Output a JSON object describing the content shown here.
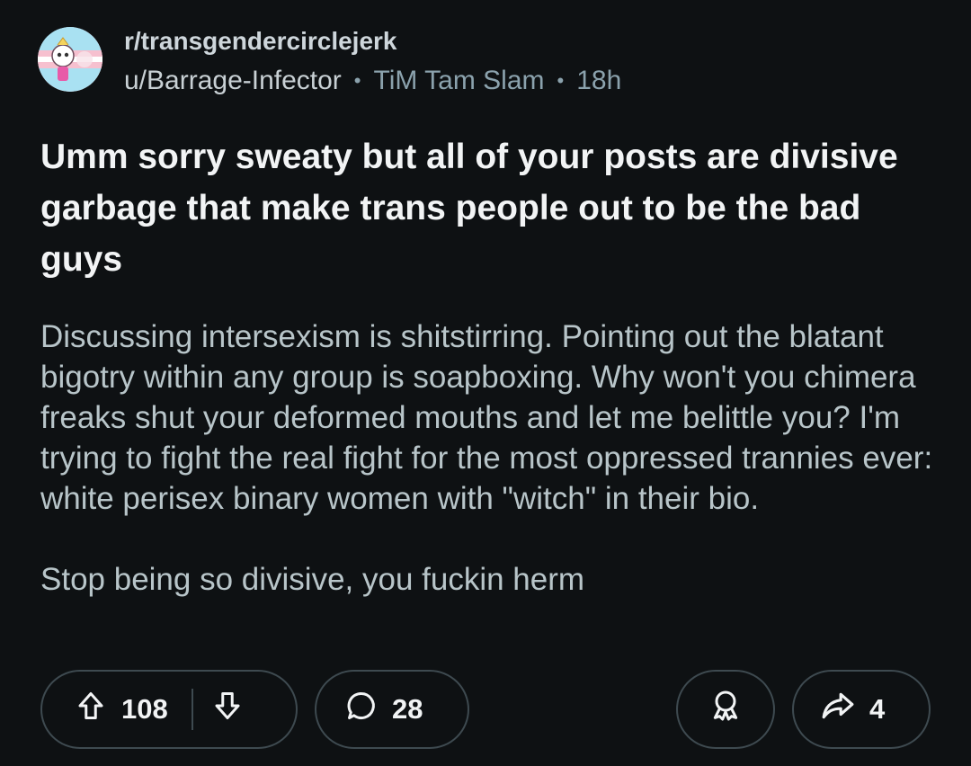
{
  "post": {
    "subreddit": "r/transgendercirclejerk",
    "author": "u/Barrage-Infector",
    "flair": "TiM Tam Slam",
    "time": "18h",
    "separator": "•",
    "title": "Umm sorry sweaty but all of your posts are divisive garbage that make trans people out to be the bad guys",
    "body_paragraphs": [
      "Discussing intersexism is shitstirring. Pointing out the blatant bigotry within any group is soapboxing. Why won't you chimera freaks shut your deformed mouths and let me belittle you? I'm trying to fight the real fight for the most oppressed trannies ever: white perisex binary women with \"witch\" in their bio.",
      "Stop being so divisive, you fuckin herm"
    ]
  },
  "actions": {
    "upvotes": "108",
    "comments": "28",
    "shares": "4"
  },
  "icons": {
    "upvote": "arrow-up-icon",
    "downvote": "arrow-down-icon",
    "comment": "speech-bubble-icon",
    "award": "award-ribbon-icon",
    "share": "share-arrow-icon",
    "avatar": "subreddit-avatar"
  },
  "colors": {
    "background": "#0e1113",
    "title": "#f2f4f5",
    "body": "#b8c5c9",
    "meta": "#8ba2ad",
    "pill_border": "#3e4a50"
  }
}
